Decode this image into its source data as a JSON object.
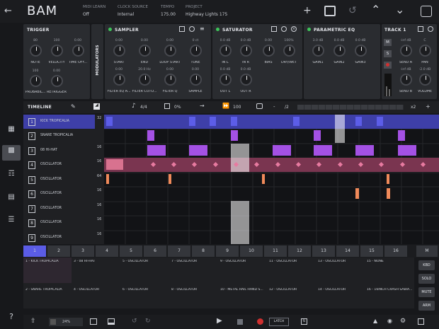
{
  "app": {
    "title": "BAM"
  },
  "header": {
    "midi_learn": {
      "label": "MIDI LEARN",
      "value": "Off"
    },
    "clock_source": {
      "label": "CLOCK SOURCE",
      "value": "Internal"
    },
    "tempo": {
      "label": "TEMPO",
      "value": "175.00"
    },
    "project": {
      "label": "PROJECT",
      "value": "Highway Lights 175"
    }
  },
  "trigger": {
    "title": "TRIGGER",
    "knobs": [
      {
        "value": "80",
        "label": "NOTE"
      },
      {
        "value": "100",
        "label": "VELOCITY"
      },
      {
        "value": "0.00",
        "label": "TIME OFF..."
      },
      {
        "value": "100",
        "label": "PROBABIL..."
      },
      {
        "value": "0.00",
        "label": "RETRIGGER"
      }
    ]
  },
  "modulators_label": "MODULATORS",
  "sampler": {
    "title": "SAMPLER",
    "knobs": [
      {
        "value": "0.00",
        "label": "START"
      },
      {
        "value": "0.00",
        "label": "END"
      },
      {
        "value": "0.00",
        "label": "LOOP START"
      },
      {
        "value": "0 ct",
        "label": "TUNE"
      },
      {
        "value": "0.00",
        "label": "FILTER EQ A..."
      },
      {
        "value": "20.0 Hz",
        "label": "FILTER CUTO..."
      },
      {
        "value": "0.00",
        "label": "FILTER Q"
      },
      {
        "value": "0.00",
        "label": "SAMPLE"
      }
    ]
  },
  "saturator": {
    "title": "SATURATOR",
    "knobs": [
      {
        "value": "0.0 dB",
        "label": "IN L"
      },
      {
        "value": "0.0 dB",
        "label": "IN R"
      },
      {
        "value": "0.00",
        "label": "BIAS"
      },
      {
        "value": "100%",
        "label": "DRY/WET"
      },
      {
        "value": "0.0 dB",
        "label": "OUT L"
      },
      {
        "value": "0.0 dB",
        "label": "OUT R"
      }
    ]
  },
  "eq": {
    "title": "PARAMETRIC EQ",
    "knobs": [
      {
        "value": "3.0 dB",
        "label": "GAIN1"
      },
      {
        "value": "0.0 dB",
        "label": "GAIN2"
      },
      {
        "value": "0.0 dB",
        "label": "GAIN3"
      }
    ]
  },
  "track_panel": {
    "title": "TRACK 1",
    "m": "M",
    "s": "S",
    "knobs": [
      {
        "value": "-inf dB",
        "label": "SEND A"
      },
      {
        "value": "C",
        "label": "PAN"
      },
      {
        "value": "-inf dB",
        "label": "SEND B"
      },
      {
        "value": "-2.0 dB",
        "label": "VOLUME"
      }
    ]
  },
  "timeline": {
    "title": "TIMELINE",
    "signature": "4/4",
    "swing": "0%",
    "bpm_rate": "100",
    "divide": "/2",
    "multiply": "x2",
    "add": "+",
    "minus": "-"
  },
  "tracks": [
    {
      "num": "1",
      "name": "KICK TROPICALIA",
      "steps": "32"
    },
    {
      "num": "2",
      "name": "SNARE TROPICALIA",
      "steps": ""
    },
    {
      "num": "3",
      "name": "08 HI-HAT",
      "steps": "16"
    },
    {
      "num": "4",
      "name": "OSCILLATOR",
      "steps": "16"
    },
    {
      "num": "5",
      "name": "OSCILLATOR",
      "steps": "64"
    },
    {
      "num": "6",
      "name": "OSCILLATOR",
      "steps": "16"
    },
    {
      "num": "7",
      "name": "OSCILLATOR",
      "steps": "16"
    },
    {
      "num": "8",
      "name": "OSCILLATOR",
      "steps": "16"
    },
    {
      "num": "9",
      "name": "OSCILLATOR",
      "steps": "16"
    }
  ],
  "steps": [
    "1",
    "2",
    "3",
    "4",
    "5",
    "6",
    "7",
    "8",
    "9",
    "10",
    "11",
    "12",
    "13",
    "14",
    "15",
    "16",
    "M"
  ],
  "patterns": [
    [
      "1 - KICK TROPICALIA",
      "3 - 08 HI-HAT",
      "5 - OSCILLATOR",
      "7 - OSCILLATOR",
      "9 - OSCILLATOR",
      "11 - OSCILLATOR",
      "13 - OSCILLATOR",
      "15 - NONE"
    ],
    [
      "2 - SNARE TROPICALIA",
      "4 - OSCILLATOR",
      "6 - OSCILLATOR",
      "8 - OSCILLATOR",
      "10 - METAL RAIL HAND S...",
      "12 - OSCILLATOR",
      "14 - OSCILLATOR",
      "16 - 16INCH CRASH SABIA..."
    ]
  ],
  "side_buttons": [
    "KBD",
    "SOLO",
    "MUTE",
    "ARM"
  ],
  "footer": {
    "zoom": "24%",
    "latch": "LATCH"
  },
  "colors": {
    "accent": "#5b5ce6",
    "clip_purple": "#a451e4",
    "clip_pink": "#d8728f",
    "clip_orange": "#f08a5a",
    "green_led": "#3ec55a",
    "record": "#d03030"
  }
}
